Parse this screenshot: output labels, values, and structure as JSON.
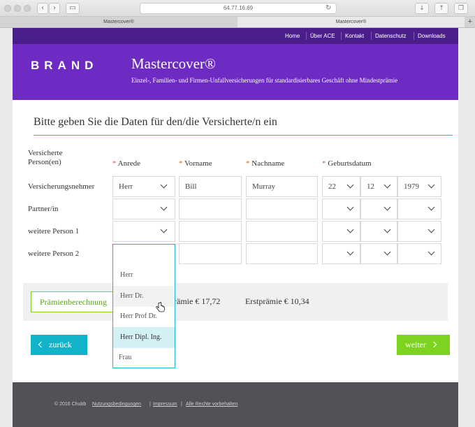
{
  "browser": {
    "url": "64.77.16.69",
    "tabs": [
      {
        "label": "Mastercover®",
        "active": false
      },
      {
        "label": "Mastercover®",
        "active": true
      }
    ],
    "new_tab": "+"
  },
  "nav": [
    "Home",
    "Über ACE",
    "Kontakt",
    "Datenschutz",
    "Downloads"
  ],
  "hero": {
    "brand": "BRAND",
    "title": "Mastercover®",
    "subtitle": "Einzel-, Familien- und Firmen-Unfallversicherungen für standardisierbares Geschäft ohne Mindestprämie"
  },
  "form": {
    "heading": "Bitte geben Sie die Daten für den/die Versicherte/n ein",
    "headers": {
      "insured": "Versicherte Person(en)",
      "salutation": "Anrede",
      "firstname": "Vorname",
      "lastname": "Nachname",
      "birthdate": "Geburtsdatum",
      "required_marker": "*"
    },
    "rows": [
      {
        "label": "Versicherungsnehmer",
        "salutation": "Herr",
        "firstname": "Bill",
        "lastname": "Murray",
        "day": "22",
        "month": "12",
        "year": "1979"
      },
      {
        "label": "Partner/in",
        "salutation": "",
        "firstname": "",
        "lastname": "",
        "day": "",
        "month": "",
        "year": ""
      },
      {
        "label": "weitere Person 1",
        "salutation": "",
        "firstname": "",
        "lastname": "",
        "day": "",
        "month": "",
        "year": ""
      },
      {
        "label": "weitere Person 2",
        "salutation": "",
        "firstname": "",
        "lastname": "",
        "day": "",
        "month": "",
        "year": ""
      }
    ]
  },
  "dropdown": {
    "options": [
      "Herr",
      "Herr Dr.",
      "Herr Prof Dr.",
      "Herr Dipl. Ing.",
      "Frau"
    ],
    "hover_index": 1,
    "selected_index": 3
  },
  "premium": {
    "button": "Prämienberechnung",
    "monthly": "prämie € 17,72",
    "first": "Erstprämie € 10,34"
  },
  "actions": {
    "back": "zurück",
    "next": "weiter"
  },
  "footer": {
    "copyright": "© 2016 Chubb",
    "links": [
      "Nutzungsbedingungen",
      "Impressum",
      "Alle Rechte vorbehalten"
    ]
  },
  "colors": {
    "nav_bg": "#4a1f8c",
    "hero_bg": "#6d2bc4",
    "accent_cyan": "#1fb5d1",
    "accent_green": "#7ed321",
    "required": "#e8643a",
    "footer_bg": "#505258"
  }
}
